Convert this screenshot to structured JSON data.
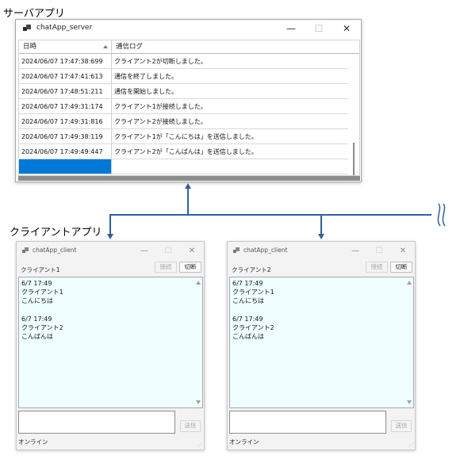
{
  "captions": {
    "server_app": "サーバアプリ",
    "client_app": "クライアントアプリ"
  },
  "server": {
    "title": "chatApp_server",
    "controls": {
      "minimize": "—",
      "maximize": "☐",
      "close": "✕"
    },
    "columns": [
      "日時",
      "通信ログ"
    ],
    "rows": [
      {
        "time": "2024/06/07 17:47:38:699",
        "log": "クライアント2が切断しました。"
      },
      {
        "time": "2024/06/07 17:47:41:613",
        "log": "通信を終了しました。"
      },
      {
        "time": "2024/06/07 17:48:51:211",
        "log": "通信を開始しました。"
      },
      {
        "time": "2024/06/07 17:49:31:174",
        "log": "クライアント1が接続しました。"
      },
      {
        "time": "2024/06/07 17:49:31:816",
        "log": "クライアント2が接続しました。"
      },
      {
        "time": "2024/06/07 17:49:38:119",
        "log": "クライアント1が「こんにちは」を送信しました。"
      },
      {
        "time": "2024/06/07 17:49:49:447",
        "log": "クライアント2が「こんばんは」を送信しました。"
      }
    ]
  },
  "clients": [
    {
      "title": "chatApp_client",
      "label": "クライアント1",
      "connect_label": "接続",
      "disconnect_label": "切断",
      "send_label": "送信",
      "status": "オンライン",
      "input_value": "",
      "log_lines": [
        "6/7 17:49",
        "クライアント1",
        "こんにちは",
        "",
        "6/7 17:49",
        "クライアント2",
        "こんばんは"
      ]
    },
    {
      "title": "chatApp_client",
      "label": "クライアント2",
      "connect_label": "接続",
      "disconnect_label": "切断",
      "send_label": "送信",
      "status": "オンライン",
      "input_value": "",
      "log_lines": [
        "6/7 17:49",
        "クライアント1",
        "こんにちは",
        "",
        "6/7 17:49",
        "クライアント2",
        "こんばんは"
      ]
    }
  ],
  "colors": {
    "connector": "#2f5fa8",
    "selection": "#0078d7",
    "log_background": "#efffff"
  }
}
